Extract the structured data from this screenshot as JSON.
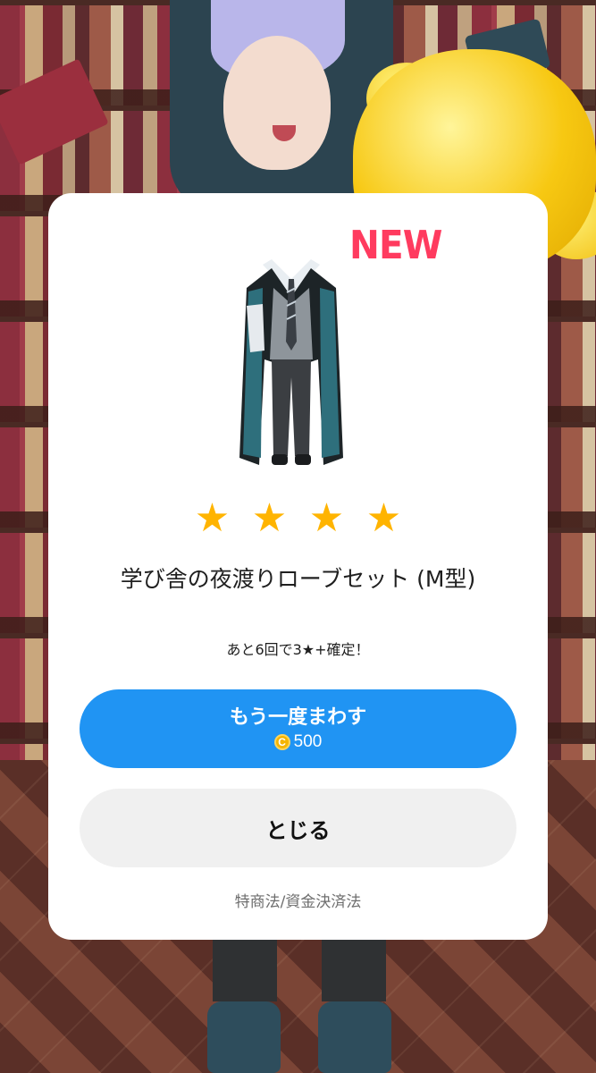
{
  "modal": {
    "badge": "NEW",
    "rarity_stars": 4,
    "star_glyph": "★",
    "item_name": "学び舎の夜渡りローブセット (M型)",
    "guarantee_text": "あと6回で3★+確定！",
    "spin_again": {
      "label": "もう一度まわす",
      "coin_icon": "coin-icon",
      "coin_glyph": "C",
      "price": "500"
    },
    "close_label": "とじる",
    "legal_link": "特商法/資金決済法"
  },
  "colors": {
    "accent_blue": "#2094f3",
    "star": "#ffb400",
    "new_badge": "#ff3b5f"
  }
}
